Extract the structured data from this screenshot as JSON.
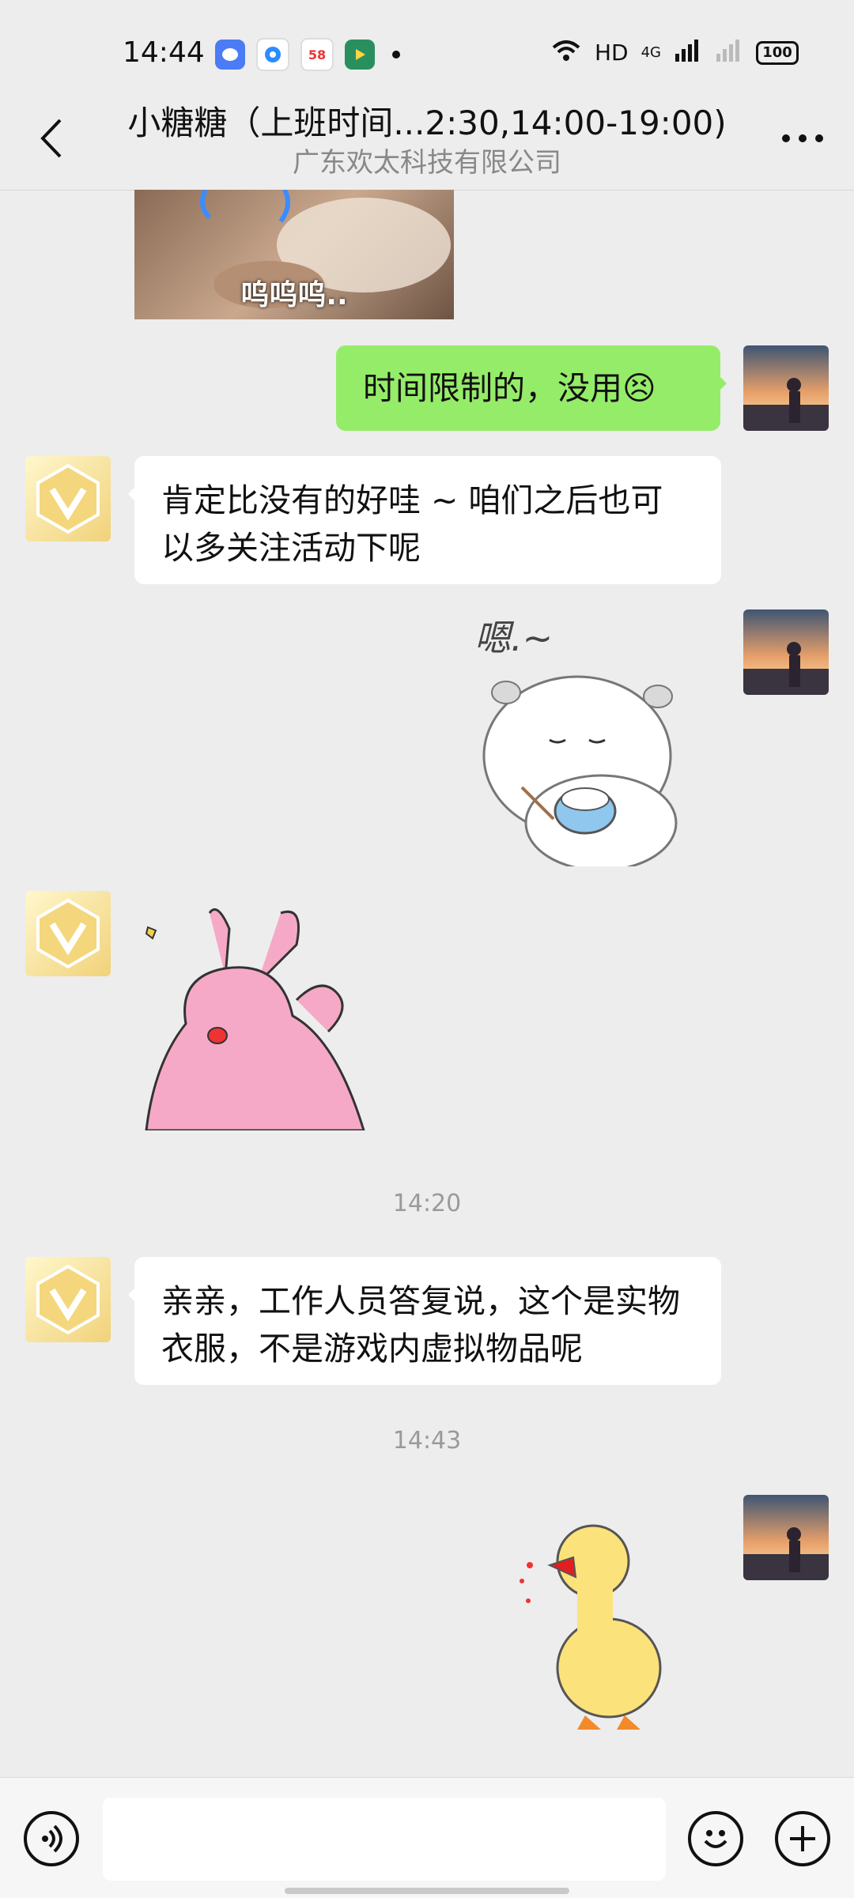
{
  "status_bar": {
    "time": "14:44",
    "network": "HD",
    "signal": "4G",
    "battery": "100"
  },
  "header": {
    "title": "小糖糖（上班时间...2:30,14:00-19:00)",
    "subtitle": "广东欢太科技有限公司"
  },
  "messages": {
    "m0_sticker_caption": "呜呜呜..",
    "m1_text": "时间限制的，没用",
    "m1_emoji": "😣",
    "m2_text": "肯定比没有的好哇 ~ 咱们之后也可以多关注活动下呢",
    "m3_sticker_text": "嗯.~",
    "ts1": "14:20",
    "m5_text": "亲亲，工作人员答复说，这个是实物衣服，不是游戏内虚拟物品呢",
    "ts2": "14:43"
  },
  "colors": {
    "background": "#ededed",
    "outgoing_bubble": "#95ec69",
    "incoming_bubble": "#ffffff"
  }
}
